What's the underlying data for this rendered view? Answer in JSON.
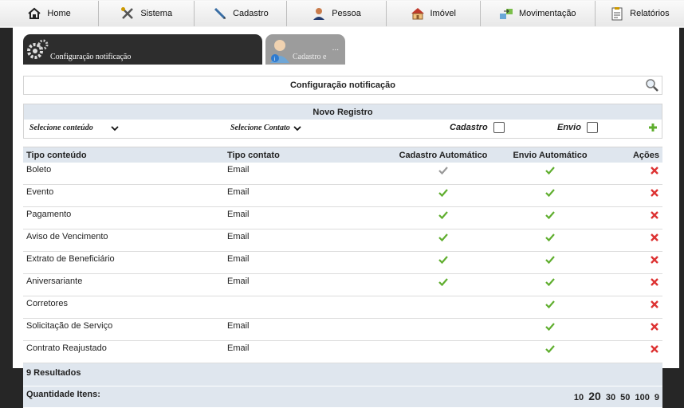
{
  "menu": [
    {
      "label": "Home",
      "icon": "home-icon"
    },
    {
      "label": "Sistema",
      "icon": "tools-icon"
    },
    {
      "label": "Cadastro",
      "icon": "pen-icon"
    },
    {
      "label": "Pessoa",
      "icon": "person-icon"
    },
    {
      "label": "Imóvel",
      "icon": "house-icon"
    },
    {
      "label": "Movimentação",
      "icon": "transfer-icon"
    },
    {
      "label": "Relatórios",
      "icon": "report-icon"
    }
  ],
  "tabs": [
    {
      "label": "Configuração notificação"
    },
    {
      "label": "Cadastro e",
      "more": "..."
    }
  ],
  "title": "Configuração notificação",
  "new_record": {
    "header": "Novo Registro",
    "content_select": "Selecione conteúdo",
    "contact_select": "Selecione Contato",
    "cadastro_label": "Cadastro",
    "envio_label": "Envio"
  },
  "table": {
    "headers": [
      "Tipo conteúdo",
      "Tipo contato",
      "Cadastro Automático",
      "Envio Automático",
      "Ações"
    ],
    "rows": [
      {
        "tipo": "Boleto",
        "contato": "Email",
        "cadastro": "grey",
        "envio": true
      },
      {
        "tipo": "Evento",
        "contato": "Email",
        "cadastro": true,
        "envio": true
      },
      {
        "tipo": "Pagamento",
        "contato": "Email",
        "cadastro": true,
        "envio": true
      },
      {
        "tipo": "Aviso de Vencimento",
        "contato": "Email",
        "cadastro": true,
        "envio": true
      },
      {
        "tipo": "Extrato de Beneficiário",
        "contato": "Email",
        "cadastro": true,
        "envio": true
      },
      {
        "tipo": "Aniversariante",
        "contato": "Email",
        "cadastro": true,
        "envio": true
      },
      {
        "tipo": "Corretores",
        "contato": "",
        "cadastro": false,
        "envio": true
      },
      {
        "tipo": "Solicitação de Serviço",
        "contato": "Email",
        "cadastro": false,
        "envio": true
      },
      {
        "tipo": "Contrato Reajustado",
        "contato": "Email",
        "cadastro": false,
        "envio": true
      }
    ],
    "results": "9 Resultados",
    "quantity_label": "Quantidade Itens:",
    "page_sizes": [
      "10",
      "20",
      "30",
      "50",
      "100",
      "9"
    ],
    "selected_page_size": "20"
  },
  "colors": {
    "check_green": "#5fae2e",
    "delete_red": "#d33",
    "header_bg": "#dfe6ee"
  }
}
